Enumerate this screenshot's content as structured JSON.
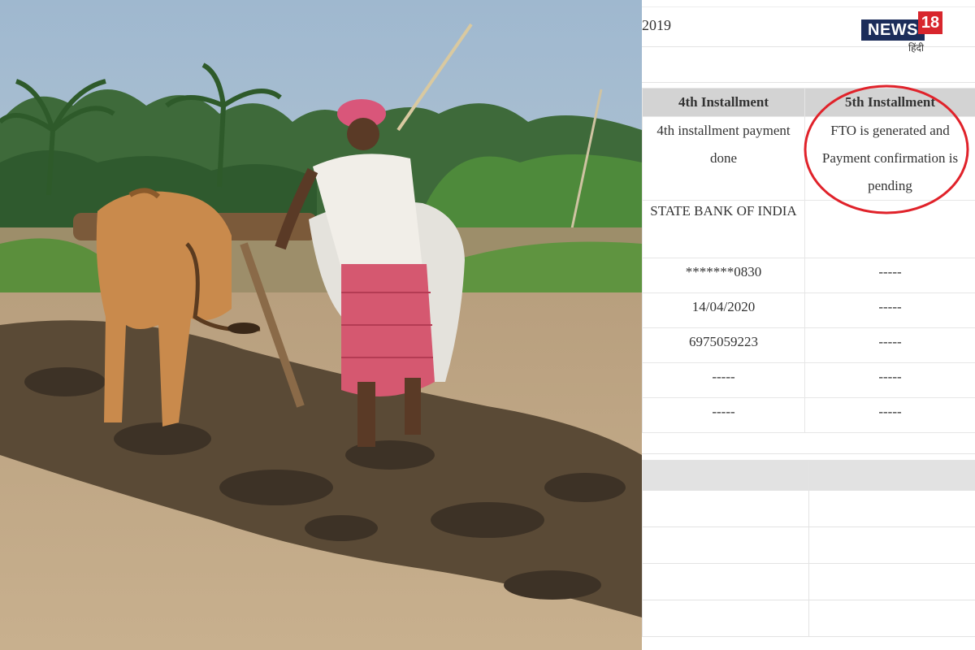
{
  "photo": {
    "description_icon": "farmer-plowing-image"
  },
  "panel": {
    "year_text": "2019",
    "logo": {
      "brand": "NEWS",
      "number": "18",
      "hindi": "हिंदी",
      "brand_color": "#1c2d5a",
      "number_color": "#d8262d"
    },
    "table": {
      "headers": [
        "4th Installment",
        "5th Installment"
      ],
      "status_row": [
        "4th installment payment done",
        "FTO is generated and Payment confirmation is pending"
      ],
      "bank_row": [
        "STATE BANK OF INDIA",
        ""
      ],
      "rows": [
        [
          "*******0830",
          "-----"
        ],
        [
          "14/04/2020",
          "-----"
        ],
        [
          "6975059223",
          "-----"
        ],
        [
          "-----",
          "-----"
        ],
        [
          "-----",
          "-----"
        ]
      ]
    },
    "highlight_color": "#e0222a"
  }
}
